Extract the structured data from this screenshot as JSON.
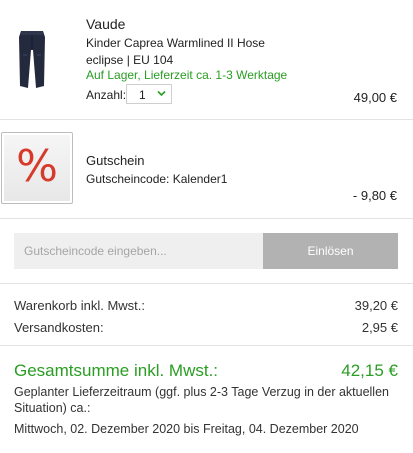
{
  "product": {
    "brand": "Vaude",
    "name": "Kinder Caprea Warmlined II Hose",
    "variant": "eclipse | EU 104",
    "stock": "Auf Lager, Lieferzeit ca. 1-3 Werktage",
    "quantity_label": "Anzahl:",
    "quantity_value": "1",
    "price": "49,00 €",
    "thumbnail_icon": "pants-icon"
  },
  "voucher": {
    "icon_symbol": "%",
    "title": "Gutschein",
    "code_text": "Gutscheincode: Kalender1",
    "amount": "- 9,80 €"
  },
  "coupon": {
    "placeholder": "Gutscheincode eingeben...",
    "button_label": "Einlösen"
  },
  "summary": {
    "cart_label": "Warenkorb inkl. Mwst.:",
    "cart_value": "39,20 €",
    "shipping_label": "Versandkosten:",
    "shipping_value": "2,95 €",
    "total_label": "Gesamtsumme inkl. Mwst.:",
    "total_value": "42,15 €"
  },
  "delivery": {
    "note": "Geplanter Lieferzeitraum (ggf. plus 2-3 Tage Verzug in der aktuellen Situation) ca.:",
    "dates": "Mittwoch, 02. Dezember 2020 bis Freitag, 04. Dezember 2020"
  },
  "colors": {
    "accent_green": "#2a9d23",
    "voucher_red": "#d63a2a",
    "button_grey": "#b2b2b2"
  }
}
